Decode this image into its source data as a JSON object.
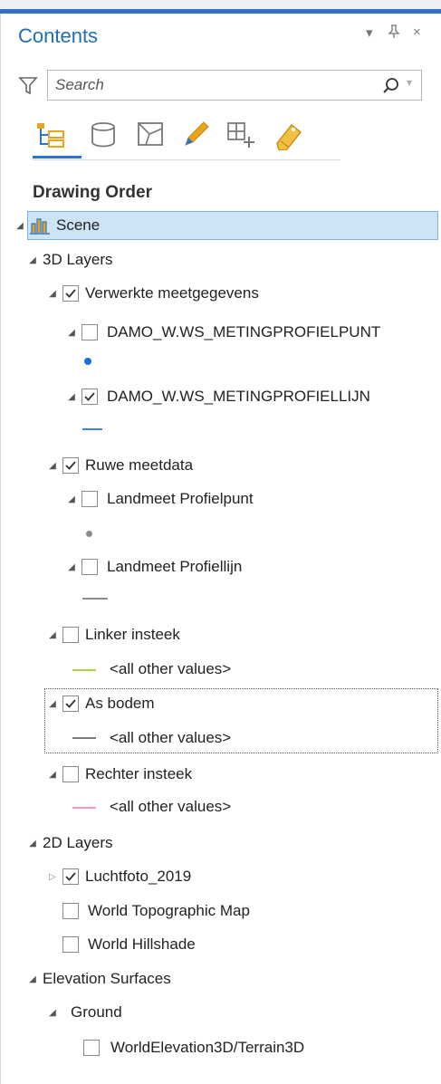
{
  "panel": {
    "title": "Contents",
    "controls": {
      "menu": "▾",
      "pin": "ᵽ",
      "close": "×"
    },
    "accent_color": "#2e74c6"
  },
  "search": {
    "placeholder": "Search"
  },
  "tabs": [
    {
      "icon": "drawing-order-icon",
      "active": true
    },
    {
      "icon": "data-source-icon",
      "active": false
    },
    {
      "icon": "selection-icon",
      "active": false
    },
    {
      "icon": "editing-icon",
      "active": false
    },
    {
      "icon": "snapping-icon",
      "active": false
    },
    {
      "icon": "labeling-icon",
      "active": false
    }
  ],
  "section_heading": "Drawing Order",
  "tree": {
    "scene": "Scene",
    "layers_3d": "3D Layers",
    "verwerkte": {
      "label": "Verwerkte meetgegevens",
      "checked": true
    },
    "profielpunt": {
      "label": "DAMO_W.WS_METINGPROFIELPUNT",
      "checked": false,
      "symbol_color": "#1a6fe0"
    },
    "profiellijn": {
      "label": "DAMO_W.WS_METINGPROFIELLIJN",
      "checked": true,
      "symbol_color": "#3b82e8"
    },
    "ruwe": {
      "label": "Ruwe meetdata",
      "checked": true
    },
    "landmeet_punt": {
      "label": "Landmeet Profielpunt",
      "checked": false,
      "symbol_color": "#8c8c8c"
    },
    "landmeet_lijn": {
      "label": "Landmeet Profiellijn",
      "checked": false,
      "symbol_color": "#8c8c8c"
    },
    "linker": {
      "label": "Linker insteek",
      "checked": false,
      "legend": "<all other values>",
      "symbol_color": "#a8d84a"
    },
    "as_bodem": {
      "label": "As bodem",
      "checked": true,
      "legend": "<all other values>",
      "symbol_color": "#7a7a7a"
    },
    "rechter": {
      "label": "Rechter insteek",
      "checked": false,
      "legend": "<all other values>",
      "symbol_color": "#f2a0b4"
    },
    "layers_2d": "2D Layers",
    "luchtfoto": {
      "label": "Luchtfoto_2019",
      "checked": true
    },
    "topo": {
      "label": "World Topographic Map",
      "checked": false
    },
    "hillshade": {
      "label": "World Hillshade",
      "checked": false
    },
    "elevation": "Elevation Surfaces",
    "ground": "Ground",
    "terrain": {
      "label": "WorldElevation3D/Terrain3D",
      "checked": false
    }
  }
}
